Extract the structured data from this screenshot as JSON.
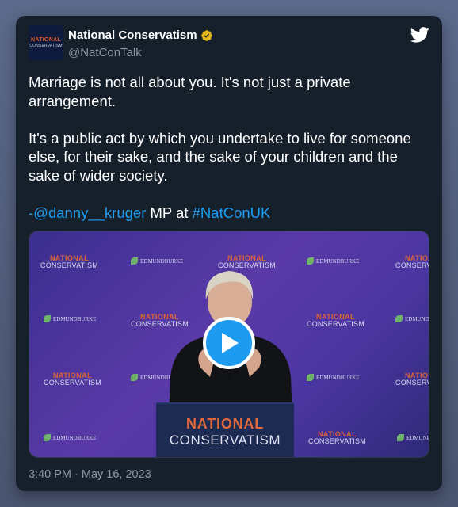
{
  "tweet": {
    "display_name": "National Conservatism",
    "handle": "@NatConTalk",
    "avatar_text": {
      "line1": "NATIONAL",
      "line2": "CONSERVATISM"
    },
    "paragraph1": "Marriage is not all about you. It's not just a private arrangement.",
    "paragraph2": "It's a public act by which you undertake to live for someone else, for their sake, and the sake of your children and the sake of wider society.",
    "attribution": {
      "prefix": "-",
      "mention": "@danny__kruger",
      "middle": " MP at ",
      "hashtag": "#NatConUK"
    },
    "timestamp": "3:40 PM · May 16, 2023"
  },
  "media": {
    "type": "video",
    "backdrop_logo": {
      "line1": "NATIONAL",
      "line2": "CONSERVATISM"
    },
    "backdrop_partner": "EDMUNDBURKE",
    "podium": {
      "line1": "NATIONAL",
      "line2": "CONSERVATISM"
    }
  },
  "icons": {
    "verified": "verified-badge-icon",
    "platform": "twitter-bird-icon",
    "play": "play-icon"
  },
  "colors": {
    "card_bg": "#15202b",
    "text": "#ffffff",
    "secondary_text": "#8b98a5",
    "link": "#1d9bf0",
    "verified_gold": "#e2b719",
    "backdrop_purple": "#4a36a0",
    "brand_orange": "#e0693b"
  }
}
